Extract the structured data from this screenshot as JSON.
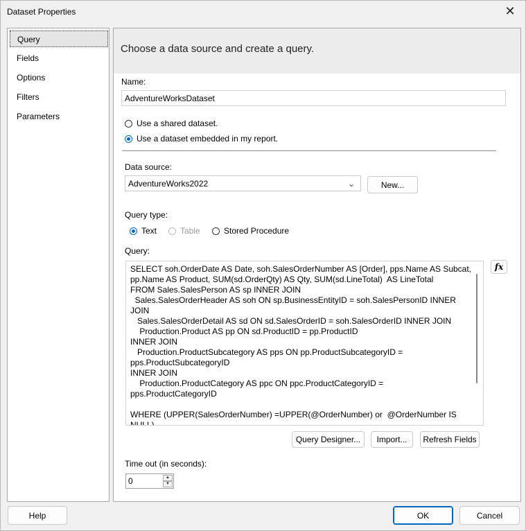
{
  "window": {
    "title": "Dataset Properties"
  },
  "nav": {
    "items": [
      {
        "label": "Query",
        "selected": true
      },
      {
        "label": "Fields",
        "selected": false
      },
      {
        "label": "Options",
        "selected": false
      },
      {
        "label": "Filters",
        "selected": false
      },
      {
        "label": "Parameters",
        "selected": false
      }
    ]
  },
  "content": {
    "heading": "Choose a data source and create a query.",
    "name_label": "Name:",
    "name_value": "AdventureWorksDataset",
    "dataset_options": [
      {
        "label": "Use a shared dataset.",
        "checked": false
      },
      {
        "label": "Use a dataset embedded in my report.",
        "checked": true
      }
    ],
    "datasource_label": "Data source:",
    "datasource_value": "AdventureWorks2022",
    "new_button": "New...",
    "query_type_label": "Query type:",
    "query_types": [
      {
        "label": "Text",
        "checked": true,
        "disabled": false
      },
      {
        "label": "Table",
        "checked": false,
        "disabled": true
      },
      {
        "label": "Stored Procedure",
        "checked": false,
        "disabled": false
      }
    ],
    "query_label": "Query:",
    "query_text": "SELECT soh.OrderDate AS Date, soh.SalesOrderNumber AS [Order], pps.Name AS Subcat,\npp.Name AS Product, SUM(sd.OrderQty) AS Qty, SUM(sd.LineTotal)  AS LineTotal\nFROM Sales.SalesPerson AS sp INNER JOIN\n  Sales.SalesOrderHeader AS soh ON sp.BusinessEntityID = soh.SalesPersonID INNER JOIN\n   Sales.SalesOrderDetail AS sd ON sd.SalesOrderID = soh.SalesOrderID INNER JOIN\n    Production.Product AS pp ON sd.ProductID = pp.ProductID\nINNER JOIN\n   Production.ProductSubcategory AS pps ON pp.ProductSubcategoryID =\npps.ProductSubcategoryID\nINNER JOIN\n    Production.ProductCategory AS ppc ON ppc.ProductCategoryID =\npps.ProductCategoryID\n\nWHERE (UPPER(SalesOrderNumber) =UPPER(@OrderNumber) or  @OrderNumber IS NULL)",
    "fx_label": "fx",
    "query_designer_button": "Query Designer...",
    "import_button": "Import...",
    "refresh_fields_button": "Refresh Fields",
    "timeout_label": "Time out (in seconds):",
    "timeout_value": "0"
  },
  "footer": {
    "help_button": "Help",
    "ok_button": "OK",
    "cancel_button": "Cancel"
  },
  "colors": {
    "accent": "#0067c0",
    "banner": "#ececec"
  }
}
